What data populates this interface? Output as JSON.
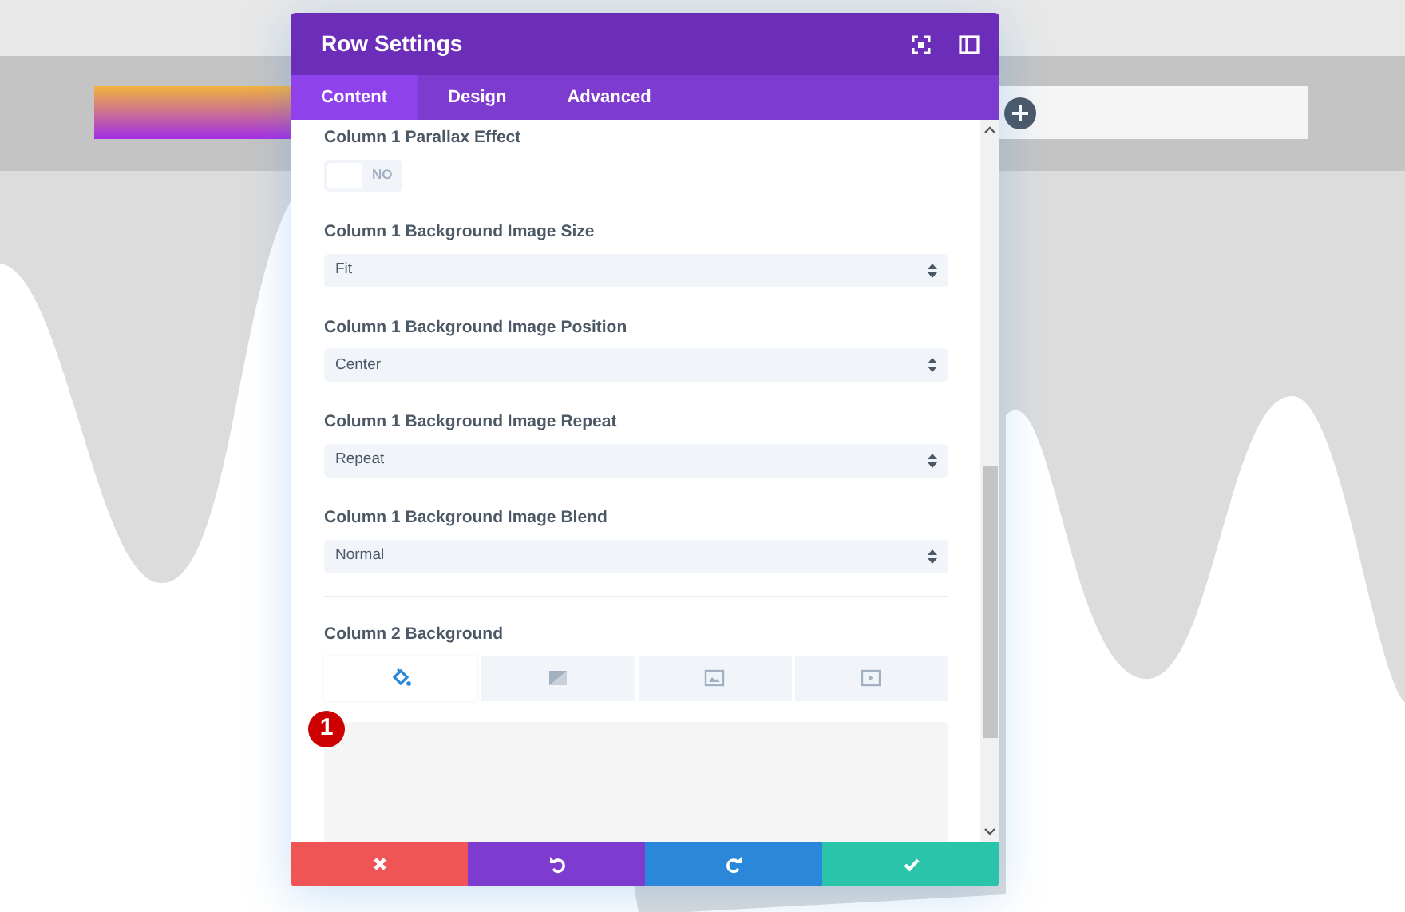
{
  "window": {
    "title": "Row Settings"
  },
  "tabs": [
    {
      "label": "Content",
      "selected": true
    },
    {
      "label": "Design",
      "selected": false
    },
    {
      "label": "Advanced",
      "selected": false
    }
  ],
  "fields": [
    {
      "kind": "toggle",
      "label": "Column 1 Parallax Effect",
      "on": false,
      "state_label": "NO"
    },
    {
      "kind": "select",
      "label": "Column 1 Background Image Size",
      "value": "Fit"
    },
    {
      "kind": "select",
      "label": "Column 1 Background Image Position",
      "value": "Center"
    },
    {
      "kind": "select",
      "label": "Column 1 Background Image Repeat",
      "value": "Repeat"
    },
    {
      "kind": "select",
      "label": "Column 1 Background Image Blend",
      "value": "Normal"
    }
  ],
  "background_section": {
    "label": "Column 2 Background",
    "tabs": [
      {
        "kind": "color",
        "selected": true
      },
      {
        "kind": "gradient",
        "selected": false
      },
      {
        "kind": "image",
        "selected": false
      },
      {
        "kind": "video",
        "selected": false
      }
    ],
    "badge": "1"
  },
  "footer_buttons": [
    {
      "kind": "cancel"
    },
    {
      "kind": "undo"
    },
    {
      "kind": "redo"
    },
    {
      "kind": "save"
    }
  ]
}
